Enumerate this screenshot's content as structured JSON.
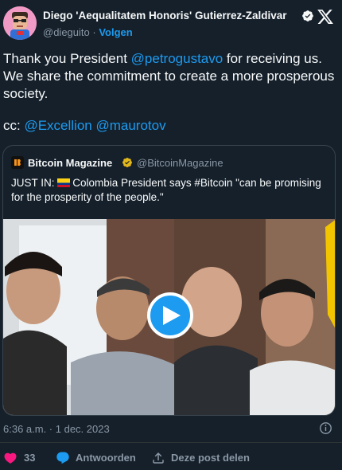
{
  "author": {
    "name": "Diego 'Aequalitatem Honoris' Gutierrez-Zaldivar",
    "handle": "@dieguito",
    "separator": "·",
    "follow_label": "Volgen"
  },
  "tweet": {
    "line1_prefix": "Thank you President ",
    "mention1": "@petrogustavo",
    "line1_suffix": " for receiving us. We share the commitment to create a more prosperous society.",
    "cc_prefix": "cc: ",
    "mention2": "@Excellion",
    "mention3": "@maurotov"
  },
  "quoted": {
    "name": "Bitcoin Magazine",
    "handle": "@BitcoinMagazine",
    "text_prefix": "JUST IN: ",
    "text_body": "Colombia President says #Bitcoin \"can be promising for the prosperity of the people.\""
  },
  "meta": {
    "timestamp": "6:36 a.m. · 1 dec. 2023"
  },
  "actions": {
    "likes": "33",
    "reply_label": "Antwoorden",
    "share_label": "Deze post delen"
  },
  "colors": {
    "background": "#15202b",
    "accent": "#1d9bf0",
    "like": "#f91880",
    "muted": "#8b98a5",
    "gold_badge": "#e2b719"
  },
  "icons": [
    "x-logo-icon",
    "verified-badge-icon",
    "gold-verified-badge-icon",
    "play-icon",
    "info-icon",
    "heart-icon",
    "reply-icon",
    "share-icon"
  ]
}
